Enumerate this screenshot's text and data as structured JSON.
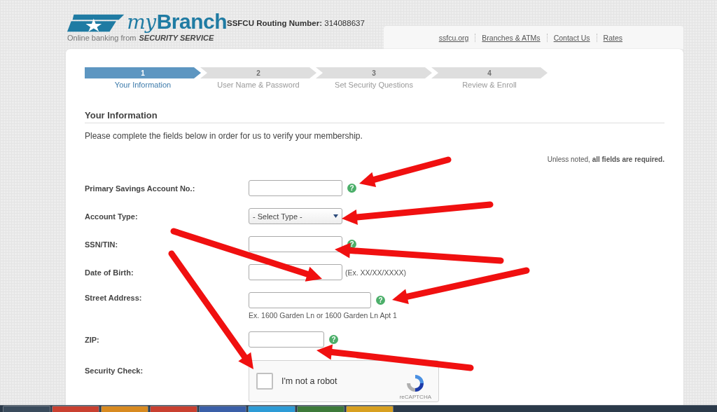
{
  "header": {
    "logo": {
      "prefix": "my",
      "brand": "Branch",
      "tagline": "Online banking from",
      "company": "SECURITY SERVICE"
    },
    "routing": {
      "label": "SSFCU Routing Number:",
      "value": "314088637"
    }
  },
  "nav_links": [
    "ssfcu.org",
    "Branches & ATMs",
    "Contact Us",
    "Rates"
  ],
  "steps": [
    {
      "number": "1",
      "label": "Your Information",
      "selected": true
    },
    {
      "number": "2",
      "label": "User Name & Password",
      "selected": false
    },
    {
      "number": "3",
      "label": "Set Security Questions",
      "selected": false
    },
    {
      "number": "4",
      "label": "Review & Enroll",
      "selected": false
    }
  ],
  "section_title": "Your Information",
  "intro": "Please complete the fields below in order for us to verify your membership.",
  "required_note": "Unless noted, **all fields are required.**",
  "fields": [
    {
      "kind": "text",
      "label": "Primary Savings Account No.:",
      "help": "?"
    },
    {
      "kind": "select",
      "label": "Account Type:",
      "value": "- Select Type -"
    },
    {
      "kind": "text",
      "label": "SSN/TIN:",
      "help": "?"
    },
    {
      "kind": "date",
      "label": "Date of Birth:",
      "example": "(Ex. XX/XX/XXXX)"
    },
    {
      "kind": "address",
      "label": "Street Address:",
      "example": "Ex. 1600 Garden Ln or 1600 Garden Ln Apt 1",
      "help": "?"
    },
    {
      "kind": "zip",
      "label": "ZIP:",
      "help": "?"
    },
    {
      "kind": "captcha",
      "label": "Security Check:",
      "checkbox_label": "I'm not a robot",
      "checked": false,
      "brand": "reCAPTCHA"
    }
  ]
}
